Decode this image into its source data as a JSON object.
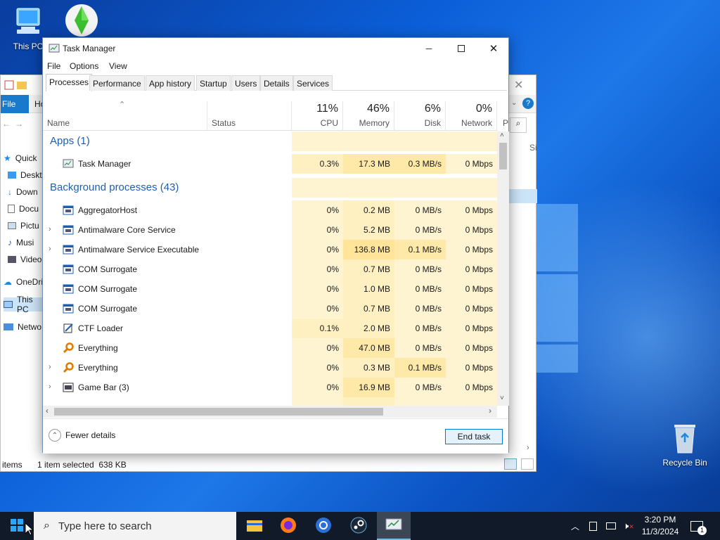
{
  "desktop": {
    "icons": [
      {
        "label": "This PC",
        "icon": "this-pc-icon"
      },
      {
        "label": "",
        "icon": "sims-plumbob-icon"
      },
      {
        "label": "Recycle Bin",
        "icon": "recycle-bin-icon"
      }
    ]
  },
  "explorer": {
    "file_tab": "File",
    "home_tab": "Ho",
    "nav_items": [
      "Quick",
      "Deskt",
      "Down",
      "Docu",
      "Pictu",
      "Musi",
      "Video",
      "OneDri",
      "This PC",
      "Netwo"
    ],
    "status_items": "items",
    "status_selected": "1 item selected  638 KB",
    "col_si": "Si"
  },
  "taskmanager": {
    "title": "Task Manager",
    "menu": [
      "File",
      "Options",
      "View"
    ],
    "tabs": [
      "Processes",
      "Performance",
      "App history",
      "Startup",
      "Users",
      "Details",
      "Services"
    ],
    "active_tab": "Processes",
    "columns": {
      "name": "Name",
      "status": "Status",
      "cpu_pct": "11%",
      "cpu": "CPU",
      "mem_pct": "46%",
      "mem": "Memory",
      "disk_pct": "6%",
      "disk": "Disk",
      "net_pct": "0%",
      "net": "Network",
      "power_partial": "P"
    },
    "groups": {
      "apps": "Apps (1)",
      "background": "Background processes (43)"
    },
    "apps": [
      {
        "name": "Task Manager",
        "cpu": "0.3%",
        "mem": "17.3 MB",
        "disk": "0.3 MB/s",
        "net": "0 Mbps",
        "icon": "task-manager-icon",
        "expandable": false
      }
    ],
    "background": [
      {
        "name": "AggregatorHost",
        "cpu": "0%",
        "mem": "0.2 MB",
        "disk": "0 MB/s",
        "net": "0 Mbps",
        "icon": "process-window-icon",
        "expandable": false
      },
      {
        "name": "Antimalware Core Service",
        "cpu": "0%",
        "mem": "5.2 MB",
        "disk": "0 MB/s",
        "net": "0 Mbps",
        "icon": "process-window-icon",
        "expandable": true
      },
      {
        "name": "Antimalware Service Executable",
        "cpu": "0%",
        "mem": "136.8 MB",
        "disk": "0.1 MB/s",
        "net": "0 Mbps",
        "icon": "process-window-icon",
        "expandable": true
      },
      {
        "name": "COM Surrogate",
        "cpu": "0%",
        "mem": "0.7 MB",
        "disk": "0 MB/s",
        "net": "0 Mbps",
        "icon": "process-window-icon",
        "expandable": false
      },
      {
        "name": "COM Surrogate",
        "cpu": "0%",
        "mem": "1.0 MB",
        "disk": "0 MB/s",
        "net": "0 Mbps",
        "icon": "process-window-icon",
        "expandable": false
      },
      {
        "name": "COM Surrogate",
        "cpu": "0%",
        "mem": "0.7 MB",
        "disk": "0 MB/s",
        "net": "0 Mbps",
        "icon": "process-window-icon",
        "expandable": false
      },
      {
        "name": "CTF Loader",
        "cpu": "0.1%",
        "mem": "2.0 MB",
        "disk": "0 MB/s",
        "net": "0 Mbps",
        "icon": "ctf-loader-icon",
        "expandable": false
      },
      {
        "name": "Everything",
        "cpu": "0%",
        "mem": "47.0 MB",
        "disk": "0 MB/s",
        "net": "0 Mbps",
        "icon": "everything-search-icon",
        "expandable": false
      },
      {
        "name": "Everything",
        "cpu": "0%",
        "mem": "0.3 MB",
        "disk": "0.1 MB/s",
        "net": "0 Mbps",
        "icon": "everything-search-icon",
        "expandable": true
      },
      {
        "name": "Game Bar (3)",
        "cpu": "0%",
        "mem": "16.9 MB",
        "disk": "0 MB/s",
        "net": "0 Mbps",
        "icon": "process-window-icon",
        "expandable": true
      }
    ],
    "footer": {
      "fewer_details": "Fewer details",
      "end_task": "End task"
    }
  },
  "taskbar": {
    "search_placeholder": "Type here to search",
    "apps": [
      "file-explorer-icon",
      "firefox-icon",
      "chrome-icon",
      "steam-icon",
      "task-manager-icon"
    ],
    "clock_time": "3:20 PM",
    "clock_date": "11/3/2024",
    "notification_count": "1"
  }
}
